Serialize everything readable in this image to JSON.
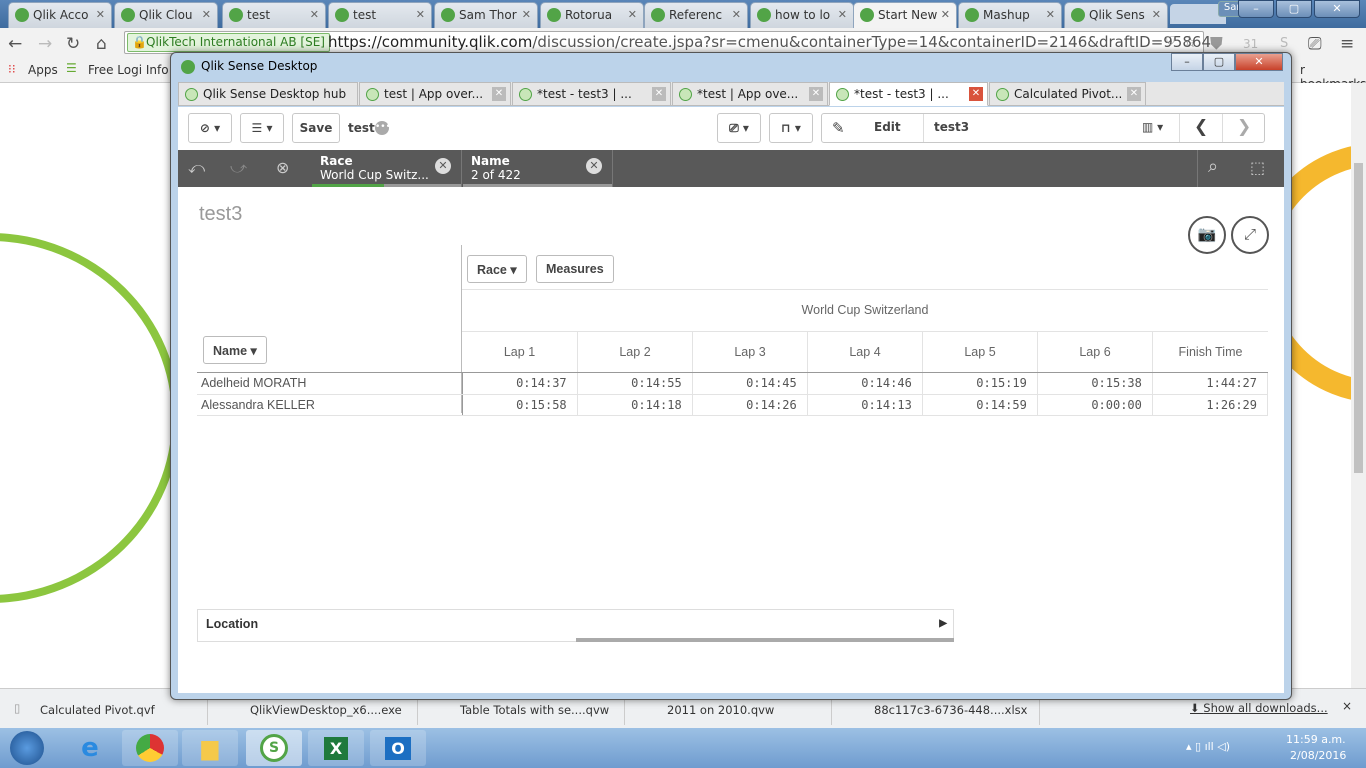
{
  "browser": {
    "tabs": [
      {
        "label": "Qlik Acco",
        "icon": "gmail-icon"
      },
      {
        "label": "Qlik Clou",
        "icon": "qlik-icon"
      },
      {
        "label": "test",
        "icon": "qlik-icon"
      },
      {
        "label": "test",
        "icon": "qlik-icon"
      },
      {
        "label": "Sam Thor",
        "icon": "drive-icon"
      },
      {
        "label": "Rotorua",
        "icon": "weather-icon"
      },
      {
        "label": "Referenc",
        "icon": "qlik-icon"
      },
      {
        "label": "how to lo",
        "icon": "google-icon"
      },
      {
        "label": "Start New",
        "icon": "qlik-icon",
        "active": true
      },
      {
        "label": "Mashup",
        "icon": "qlik-sense-icon"
      },
      {
        "label": "Qlik Sens",
        "icon": "qlik-sense-icon"
      }
    ],
    "user": "Sam",
    "secure_label": "QlikTech International AB [SE]",
    "url_host": "https://community.qlik.com",
    "url_path": "/discussion/create.jspa?sr=cmenu&containerType=14&containerID=2146&draftID=95864",
    "bookmarks": [
      {
        "label": "Apps"
      },
      {
        "label": "Free Logi Info T"
      }
    ],
    "bookmarks_other": "r bookmarks"
  },
  "downloads": {
    "items": [
      "Calculated Pivot.qvf",
      "QlikViewDesktop_x6....exe",
      "Table Totals with se....qvw",
      "2011 on 2010.qvw",
      "88c117c3-6736-448....xlsx"
    ],
    "show_all": "Show all downloads...",
    "close": "×"
  },
  "taskbar": {
    "time": "11:59 a.m.",
    "date": "2/08/2016"
  },
  "qlik": {
    "window_title": "Qlik Sense Desktop",
    "tabs": [
      {
        "label": "Qlik Sense Desktop hub"
      },
      {
        "label": "test | App over..."
      },
      {
        "label": "*test - test3 | ..."
      },
      {
        "label": "*test | App ove..."
      },
      {
        "label": "*test - test3 | ...",
        "active": true
      },
      {
        "label": "Calculated Pivot..."
      }
    ],
    "toolbar": {
      "save": "Save",
      "app_name": "test",
      "edit": "Edit",
      "sheet_name": "test3"
    },
    "selections": [
      {
        "field": "Race",
        "value": "World Cup Switz...",
        "fill": 0.48
      },
      {
        "field": "Name",
        "value": "2 of 422",
        "fill": 0
      }
    ],
    "sheet_title": "test3",
    "pivot": {
      "row_dim": "Name",
      "col_dim": "Race",
      "measures_label": "Measures",
      "race_value": "World Cup Switzerland",
      "columns": [
        "Lap 1",
        "Lap 2",
        "Lap 3",
        "Lap 4",
        "Lap 5",
        "Lap 6",
        "Finish Time"
      ],
      "rows": [
        {
          "name": "Adelheid MORATH",
          "values": [
            "0:14:37",
            "0:14:55",
            "0:14:45",
            "0:14:46",
            "0:15:19",
            "0:15:38",
            "1:44:27"
          ]
        },
        {
          "name": "Alessandra KELLER",
          "values": [
            "0:15:58",
            "0:14:18",
            "0:14:26",
            "0:14:13",
            "0:14:59",
            "0:00:00",
            "1:26:29"
          ]
        }
      ]
    },
    "filter_pane": {
      "label": "Location"
    }
  }
}
